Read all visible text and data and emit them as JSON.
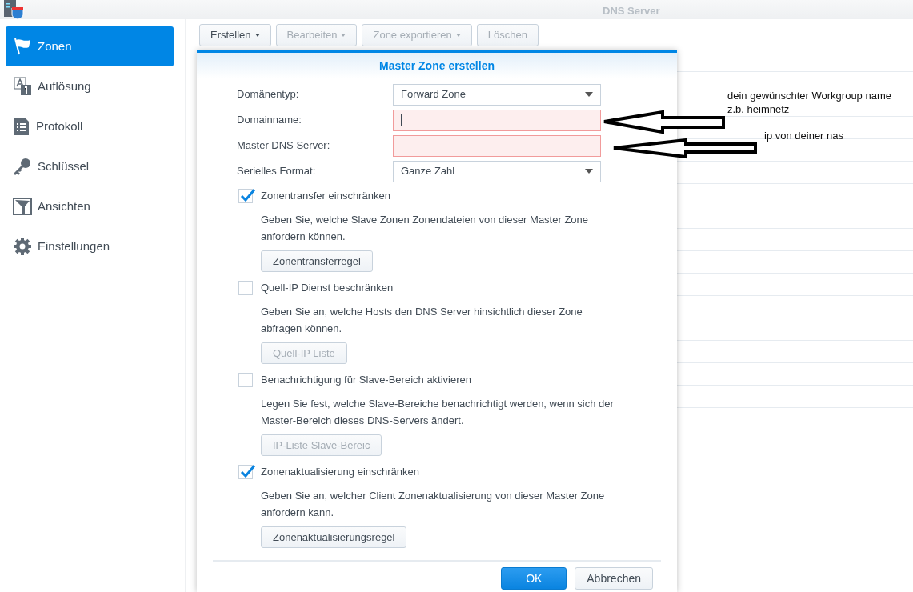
{
  "app": {
    "title": "DNS Server"
  },
  "sidebar": {
    "items": [
      {
        "label": "Zonen",
        "selected": true
      },
      {
        "label": "Auflösung",
        "selected": false
      },
      {
        "label": "Protokoll",
        "selected": false
      },
      {
        "label": "Schlüssel",
        "selected": false
      },
      {
        "label": "Ansichten",
        "selected": false
      },
      {
        "label": "Einstellungen",
        "selected": false
      }
    ]
  },
  "toolbar": {
    "buttons": [
      {
        "label": "Erstellen",
        "dropdown": true,
        "disabled": false
      },
      {
        "label": "Bearbeiten",
        "dropdown": true,
        "disabled": true
      },
      {
        "label": "Zone exportieren",
        "dropdown": true,
        "disabled": true
      },
      {
        "label": "Löschen",
        "dropdown": false,
        "disabled": true
      }
    ]
  },
  "dialog": {
    "title": "Master Zone erstellen",
    "fields": [
      {
        "label": "Domänentyp:",
        "kind": "select",
        "value": "Forward Zone",
        "invalid": false
      },
      {
        "label": "Domainname:",
        "kind": "text",
        "invalid": true,
        "focused": true
      },
      {
        "label": "Master DNS Server:",
        "kind": "text",
        "invalid": true
      },
      {
        "label": "Serielles Format:",
        "kind": "select",
        "value": "Ganze Zahl",
        "invalid": false
      }
    ],
    "options": [
      {
        "label": "Zonentransfer einschränken",
        "checked": true,
        "description": "Geben Sie, welche Slave Zonen Zonendateien von dieser Master Zone anfordern können.",
        "button": {
          "label": "Zonentransferregel",
          "disabled": false
        }
      },
      {
        "label": "Quell-IP Dienst beschränken",
        "checked": false,
        "description": "Geben Sie an, welche Hosts den DNS Server hinsichtlich dieser Zone abfragen können.",
        "button": {
          "label": "Quell-IP Liste",
          "disabled": true
        }
      },
      {
        "label": "Benachrichtigung für Slave-Bereich aktivieren",
        "checked": false,
        "description": "Legen Sie fest, welche Slave-Bereiche benachrichtigt werden, wenn sich der Master-Bereich dieses DNS-Servers ändert.",
        "button": {
          "label": "IP-Liste Slave-Bereic",
          "disabled": true
        }
      },
      {
        "label": "Zonenaktualisierung einschränken",
        "checked": true,
        "description": "Geben Sie an, welcher Client Zonenaktualisierung von dieser Master Zone anfordern kann.",
        "button": {
          "label": "Zonenaktualisierungsregel",
          "disabled": false
        }
      }
    ],
    "buttons": [
      {
        "label": "OK",
        "primary": true
      },
      {
        "label": "Abbrechen",
        "primary": false
      }
    ]
  },
  "annotations": [
    {
      "lines": [
        "dein gewünschter Workgroup name",
        "z.b. heimnetz"
      ]
    },
    {
      "lines": [
        "ip von deiner nas"
      ]
    }
  ]
}
